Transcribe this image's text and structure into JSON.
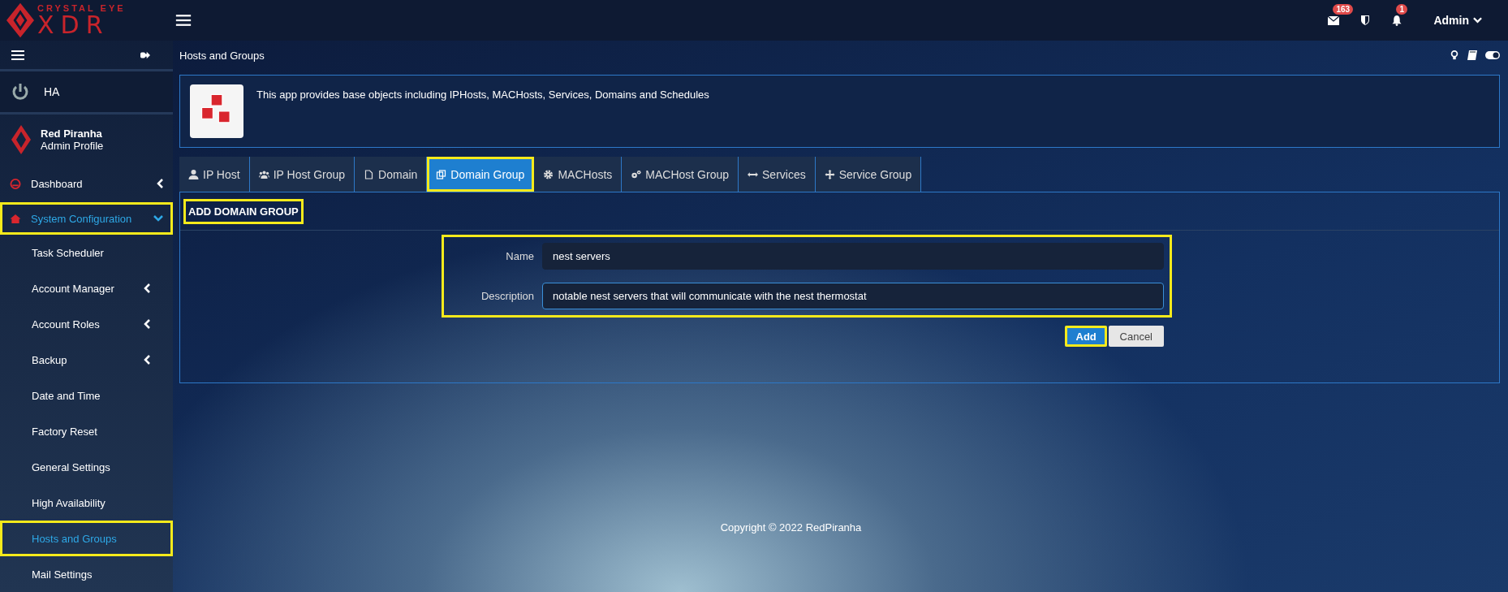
{
  "brand": {
    "tagline": "CRYSTAL EYE",
    "name": "XDR"
  },
  "topbar": {
    "notifications": [
      {
        "kind": "mail",
        "count": "163"
      },
      {
        "kind": "shield"
      },
      {
        "kind": "bell",
        "count": "1"
      }
    ],
    "user": "Admin"
  },
  "sidebar": {
    "power_item": "HA",
    "profile": {
      "name": "Red Piranha",
      "role": "Admin Profile"
    },
    "items": [
      {
        "label": "Dashboard",
        "kind": "dashboard",
        "selected": false,
        "expanded": false,
        "highlighted": false
      },
      {
        "label": "System Configuration",
        "kind": "home",
        "selected": true,
        "expanded": true,
        "highlighted": true,
        "children": [
          {
            "label": "Task Scheduler",
            "submenu": false,
            "selected": false,
            "highlighted": false
          },
          {
            "label": "Account Manager",
            "submenu": true,
            "selected": false,
            "highlighted": false
          },
          {
            "label": "Account Roles",
            "submenu": true,
            "selected": false,
            "highlighted": false
          },
          {
            "label": "Backup",
            "submenu": true,
            "selected": false,
            "highlighted": false
          },
          {
            "label": "Date and Time",
            "submenu": false,
            "selected": false,
            "highlighted": false
          },
          {
            "label": "Factory Reset",
            "submenu": false,
            "selected": false,
            "highlighted": false
          },
          {
            "label": "General Settings",
            "submenu": false,
            "selected": false,
            "highlighted": false
          },
          {
            "label": "High Availability",
            "submenu": false,
            "selected": false,
            "highlighted": false
          },
          {
            "label": "Hosts and Groups",
            "submenu": false,
            "selected": true,
            "highlighted": true
          },
          {
            "label": "Mail Settings",
            "submenu": false,
            "selected": false,
            "highlighted": false
          }
        ]
      }
    ]
  },
  "page": {
    "title": "Hosts and Groups",
    "description": "This app provides base objects including IPHosts, MACHosts, Services, Domains and Schedules"
  },
  "tabs": [
    {
      "label": "IP Host",
      "kind": "user",
      "selected": false,
      "highlighted": false
    },
    {
      "label": "IP Host Group",
      "kind": "users",
      "selected": false,
      "highlighted": false
    },
    {
      "label": "Domain",
      "kind": "file",
      "selected": false,
      "highlighted": false
    },
    {
      "label": "Domain Group",
      "kind": "copy",
      "selected": true,
      "highlighted": true
    },
    {
      "label": "MACHosts",
      "kind": "gear",
      "selected": false,
      "highlighted": false
    },
    {
      "label": "MACHost Group",
      "kind": "gears",
      "selected": false,
      "highlighted": false
    },
    {
      "label": "Services",
      "kind": "arrows",
      "selected": false,
      "highlighted": false
    },
    {
      "label": "Service Group",
      "kind": "move",
      "selected": false,
      "highlighted": false
    }
  ],
  "form": {
    "title": "ADD DOMAIN GROUP",
    "title_highlighted": true,
    "fields_highlighted": true,
    "fields": [
      {
        "label": "Name",
        "value": "nest servers",
        "focused": false
      },
      {
        "label": "Description",
        "value": "notable nest servers that will communicate with the nest thermostat",
        "focused": true
      }
    ],
    "buttons": [
      {
        "kind": "primary",
        "label": "Add",
        "highlighted": true
      },
      {
        "kind": "secondary",
        "label": "Cancel",
        "highlighted": false
      }
    ]
  },
  "footer": "Copyright © 2022 RedPiranha"
}
